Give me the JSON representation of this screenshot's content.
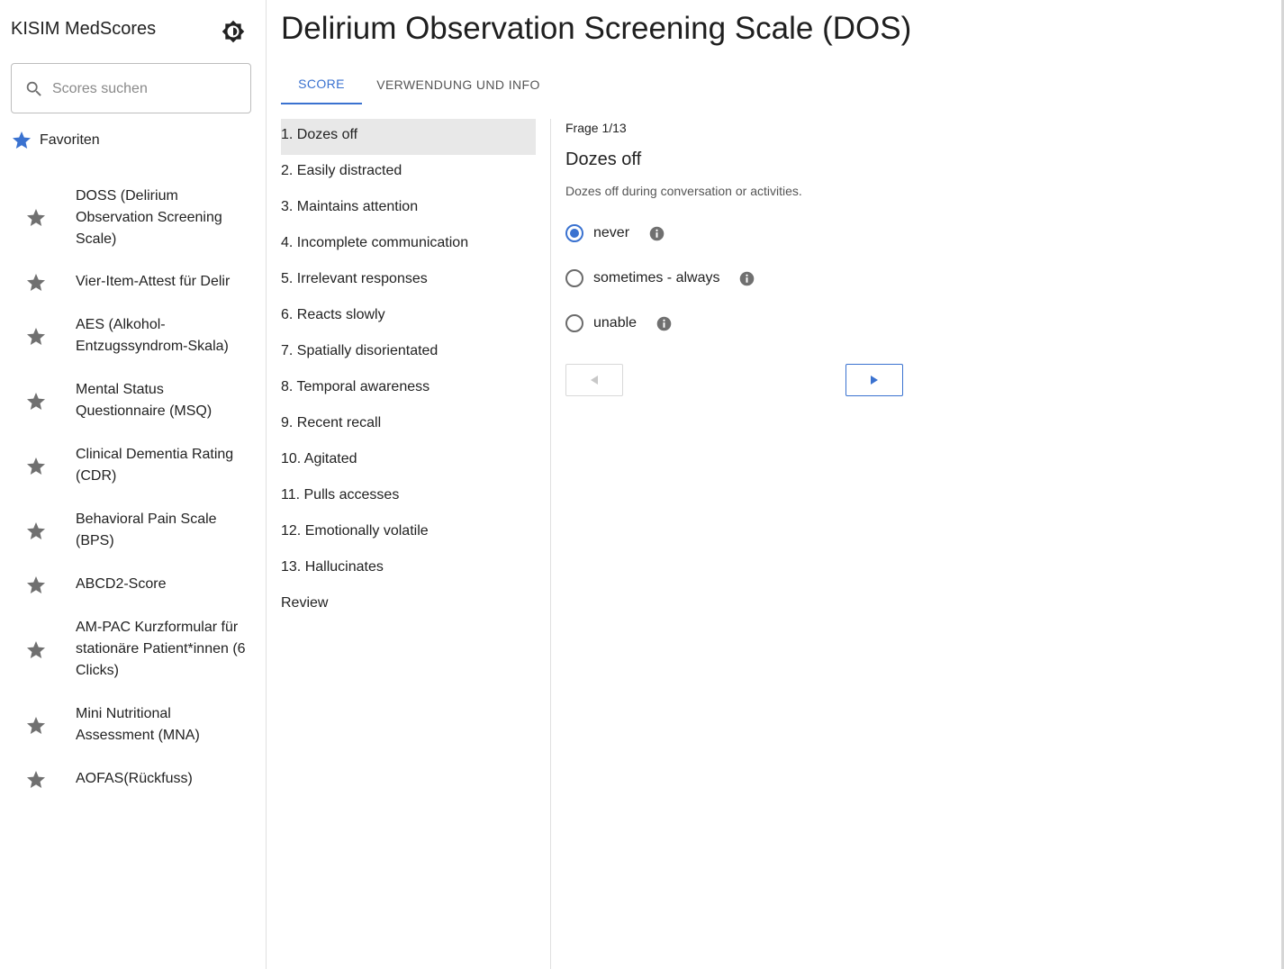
{
  "app": {
    "title": "KISIM MedScores"
  },
  "search": {
    "placeholder": "Scores suchen",
    "value": ""
  },
  "favorites": {
    "header": "Favoriten",
    "items": [
      {
        "label": "DOSS (Delirium Observation Screening Scale)"
      },
      {
        "label": "Vier-Item-Attest für Delir"
      },
      {
        "label": "AES (Alkohol-Entzugssyndrom-Skala)"
      },
      {
        "label": "Mental Status Questionnaire (MSQ)"
      },
      {
        "label": "Clinical Dementia Rating (CDR)"
      },
      {
        "label": "Behavioral Pain Scale (BPS)"
      },
      {
        "label": "ABCD2-Score"
      },
      {
        "label": "AM-PAC Kurzformular für stationäre Patient*innen (6 Clicks)"
      },
      {
        "label": "Mini Nutritional Assessment (MNA)"
      },
      {
        "label": "AOFAS(Rückfuss)"
      }
    ]
  },
  "main": {
    "title": "Delirium Observation Screening Scale (DOS)",
    "tabs": [
      {
        "label": "SCORE"
      },
      {
        "label": "VERWENDUNG UND INFO"
      }
    ]
  },
  "questions": [
    {
      "label": "1. Dozes off"
    },
    {
      "label": "2. Easily distracted"
    },
    {
      "label": "3. Maintains attention"
    },
    {
      "label": "4. Incomplete communication"
    },
    {
      "label": "5. Irrelevant responses"
    },
    {
      "label": "6. Reacts slowly"
    },
    {
      "label": "7. Spatially disorientated"
    },
    {
      "label": "8. Temporal awareness"
    },
    {
      "label": "9. Recent recall"
    },
    {
      "label": "10. Agitated"
    },
    {
      "label": "11. Pulls accesses"
    },
    {
      "label": "12. Emotionally volatile"
    },
    {
      "label": "13. Hallucinates"
    },
    {
      "label": "Review"
    }
  ],
  "current": {
    "counter": "Frage 1/13",
    "title": "Dozes off",
    "description": "Dozes off during conversation or activities.",
    "options": [
      {
        "label": "never",
        "selected": true
      },
      {
        "label": "sometimes - always",
        "selected": false
      },
      {
        "label": "unable",
        "selected": false
      }
    ]
  },
  "colors": {
    "accent": "#3a72d0",
    "active_bg": "#e8e8e8",
    "icon_gray": "#707070"
  },
  "icons": {
    "theme": "brightness-icon",
    "search": "search-icon",
    "favorite": "star-icon",
    "info": "info-icon",
    "prev": "arrow-left-icon",
    "next": "arrow-right-icon"
  }
}
